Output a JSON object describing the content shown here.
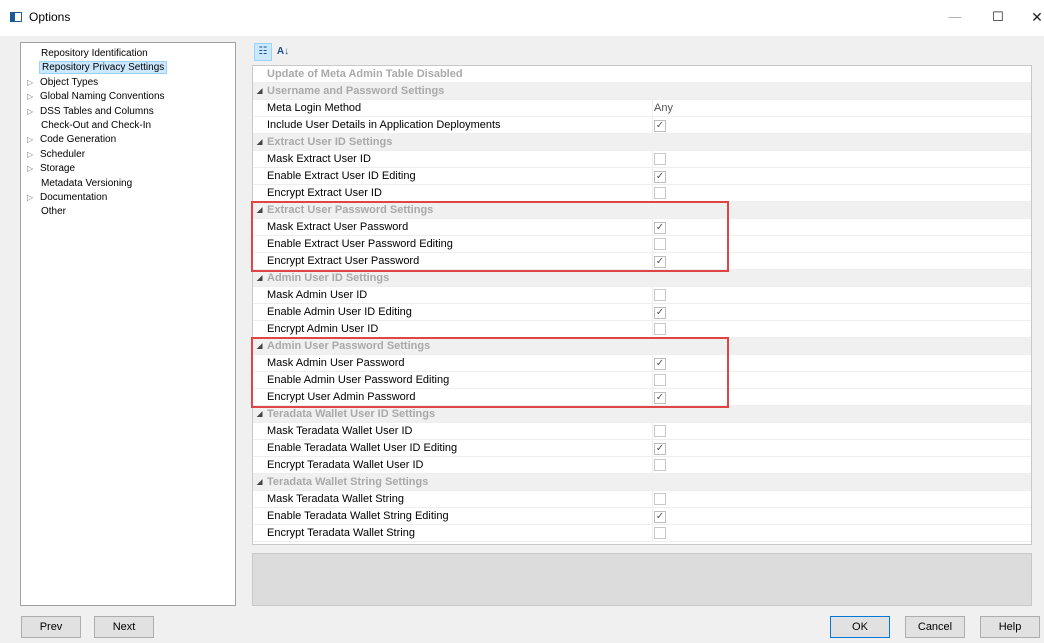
{
  "window": {
    "title": "Options",
    "minimize": "—",
    "maximize": "☐",
    "close": "✕"
  },
  "tree": {
    "items": [
      {
        "label": "Repository Identification",
        "expandable": false,
        "selected": false
      },
      {
        "label": "Repository Privacy Settings",
        "expandable": false,
        "selected": true
      },
      {
        "label": "Object Types",
        "expandable": true,
        "selected": false
      },
      {
        "label": "Global Naming Conventions",
        "expandable": true,
        "selected": false
      },
      {
        "label": "DSS Tables and Columns",
        "expandable": true,
        "selected": false
      },
      {
        "label": "Check-Out and Check-In",
        "expandable": false,
        "selected": false
      },
      {
        "label": "Code Generation",
        "expandable": true,
        "selected": false
      },
      {
        "label": "Scheduler",
        "expandable": true,
        "selected": false
      },
      {
        "label": "Storage",
        "expandable": true,
        "selected": false
      },
      {
        "label": "Metadata Versioning",
        "expandable": false,
        "selected": false
      },
      {
        "label": "Documentation",
        "expandable": true,
        "selected": false
      },
      {
        "label": "Other",
        "expandable": false,
        "selected": false
      }
    ]
  },
  "toolbar": {
    "categorized_glyph": "☷",
    "alphabetical_glyph": "A↓"
  },
  "grid": {
    "top_row": "Update of Meta Admin Table Disabled",
    "categories": [
      {
        "label": "Username and Password Settings",
        "rows": [
          {
            "name": "Meta Login Method",
            "type": "text",
            "value": "Any"
          },
          {
            "name": "Include User Details in Application Deployments",
            "type": "check",
            "checked": true
          }
        ]
      },
      {
        "label": "Extract User ID Settings",
        "rows": [
          {
            "name": "Mask Extract User ID",
            "type": "check",
            "checked": false
          },
          {
            "name": "Enable Extract User ID Editing",
            "type": "check",
            "checked": true
          },
          {
            "name": "Encrypt Extract User ID",
            "type": "check",
            "checked": false
          }
        ]
      },
      {
        "label": "Extract User Password Settings",
        "highlighted": true,
        "rows": [
          {
            "name": "Mask Extract User Password",
            "type": "check",
            "checked": true
          },
          {
            "name": "Enable Extract User Password Editing",
            "type": "check",
            "checked": false
          },
          {
            "name": "Encrypt Extract User Password",
            "type": "check",
            "checked": true
          }
        ]
      },
      {
        "label": "Admin User ID Settings",
        "rows": [
          {
            "name": "Mask Admin User ID",
            "type": "check",
            "checked": false
          },
          {
            "name": "Enable Admin User ID Editing",
            "type": "check",
            "checked": true
          },
          {
            "name": "Encrypt Admin User ID",
            "type": "check",
            "checked": false
          }
        ]
      },
      {
        "label": "Admin User Password Settings",
        "highlighted": true,
        "rows": [
          {
            "name": "Mask Admin User Password",
            "type": "check",
            "checked": true
          },
          {
            "name": "Enable Admin User Password Editing",
            "type": "check",
            "checked": false
          },
          {
            "name": "Encrypt User Admin Password",
            "type": "check",
            "checked": true
          }
        ]
      },
      {
        "label": "Teradata Wallet User ID Settings",
        "rows": [
          {
            "name": "Mask Teradata Wallet User ID",
            "type": "check",
            "checked": false
          },
          {
            "name": "Enable Teradata Wallet User ID Editing",
            "type": "check",
            "checked": true
          },
          {
            "name": "Encrypt Teradata Wallet User ID",
            "type": "check",
            "checked": false
          }
        ]
      },
      {
        "label": "Teradata Wallet String Settings",
        "rows": [
          {
            "name": "Mask Teradata Wallet String",
            "type": "check",
            "checked": false
          },
          {
            "name": "Enable Teradata Wallet String Editing",
            "type": "check",
            "checked": true
          },
          {
            "name": "Encrypt Teradata Wallet String",
            "type": "check",
            "checked": false
          }
        ]
      }
    ]
  },
  "buttons": {
    "prev": "Prev",
    "next": "Next",
    "ok": "OK",
    "cancel": "Cancel",
    "help": "Help"
  },
  "colors": {
    "highlight": "#e04444",
    "selection": "#cce8ff",
    "category_text": "#a9a9a9"
  }
}
